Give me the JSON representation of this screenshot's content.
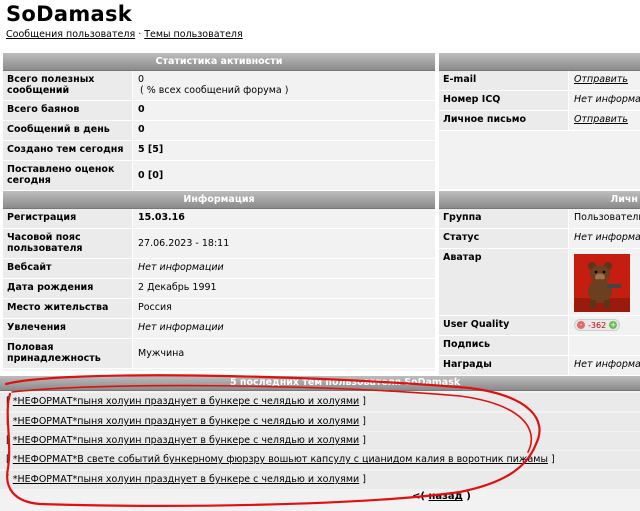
{
  "title": "SoDamask",
  "breadcrumb": {
    "posts": "Сообщения пользователя",
    "separator": "·",
    "topics": "Темы пользователя"
  },
  "stats": {
    "header": "Статистика активности",
    "rows": [
      {
        "label": "Всего полезных сообщений",
        "value": "0",
        "extra": "( % всех сообщений форума )"
      },
      {
        "label": "Всего баянов",
        "value": "0"
      },
      {
        "label": "Сообщений в день",
        "value": "0"
      },
      {
        "label": "Создано тем сегодня",
        "value": "5 [5]"
      },
      {
        "label": "Поставлено оценок сегодня",
        "value": "0 [0]"
      }
    ]
  },
  "contact": {
    "rows": [
      {
        "label": "E-mail",
        "value": "Отправить"
      },
      {
        "label": "Номер ICQ",
        "value": "Нет информации"
      },
      {
        "label": "Личное письмо",
        "value": "Отправить"
      }
    ]
  },
  "info": {
    "header": "Информация",
    "rows": [
      {
        "label": "Регистрация",
        "value": "15.03.16"
      },
      {
        "label": "Часовой пояс пользователя",
        "value": "27.06.2023 - 18:11"
      },
      {
        "label": "Вебсайт",
        "value": "Нет информации"
      },
      {
        "label": "Дата рождения",
        "value": "2 Декабрь 1991"
      },
      {
        "label": "Место жительства",
        "value": "Россия"
      },
      {
        "label": "Увлечения",
        "value": "Нет информации"
      },
      {
        "label": "Половая принадлежность",
        "value": "Мужчина"
      }
    ]
  },
  "personal": {
    "header": "Личн",
    "rows": [
      {
        "label": "Группа",
        "value": "Пользователи"
      },
      {
        "label": "Статус",
        "value": "Нет информации"
      },
      {
        "label": "Аватар",
        "value": ""
      },
      {
        "label": "User Quality",
        "minus": "-",
        "value": "-362",
        "plus": "+"
      },
      {
        "label": "Подпись",
        "value": ""
      },
      {
        "label": "Награды",
        "value": "Нет информации"
      }
    ]
  },
  "topics": {
    "header": "5 последних тем пользователя SoDamask",
    "items": [
      "*НЕФОРМАТ*пыня холуин празднует в бункере с челядью и холуями",
      "*НЕФОРМАТ*пыня холуин празднует в бункере с челядью и холуями",
      "*НЕФОРМАТ*пыня холуин празднует в бункере с челядью и холуями",
      "*НЕФОРМАТ*В свете событий бункерному фюрзру вошьют капсулу с цианидом калия в воротник пижамы",
      "*НЕФОРМАТ*пыня холуин празднует в бункере с челядью и холуями"
    ],
    "bracket_open": "[",
    "bracket_close": "]"
  },
  "back": {
    "prefix": "<(",
    "label": "назад",
    "suffix": ")"
  },
  "colors": {
    "header_gradient_top": "#bdbdbd",
    "header_gradient_bottom": "#8a8a8a",
    "scribble": "#e01010",
    "avatar_bg": "#c51e10"
  }
}
